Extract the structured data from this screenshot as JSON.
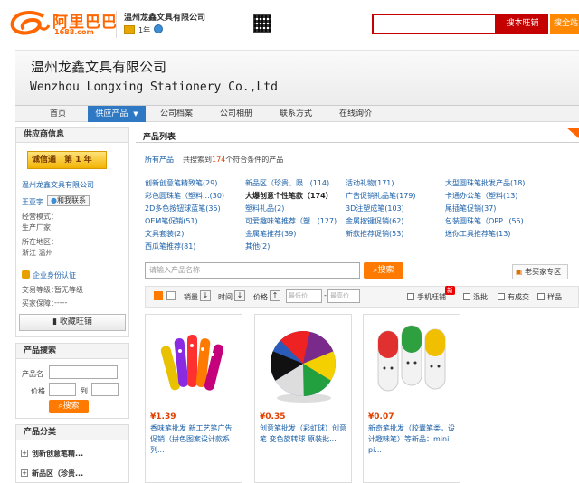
{
  "header": {
    "logo_cn": "阿里巴巴",
    "logo_url": "1688.com",
    "company_name": "温州龙鑫文具有限公司",
    "year_label": "1年",
    "search_placeholder": "",
    "search_shop_button": "搜本旺铺",
    "search_site_button": "搜全站"
  },
  "banner": {
    "title_cn": "温州龙鑫文具有限公司",
    "title_en": "Wenzhou Longxing Stationery Co.,Ltd"
  },
  "nav": {
    "items": [
      "首页",
      "供应产品",
      "公司档案",
      "公司相册",
      "联系方式",
      "在线询价"
    ],
    "active_index": 1
  },
  "supplier": {
    "heading": "供应商信息",
    "badge_text": "诚信通",
    "badge_year": "第 1 年",
    "company_link": "温州龙鑫文具有限公司",
    "contact_name": "王亚宇",
    "contact_button": "和我联系",
    "biz_model_label": "经营模式：",
    "biz_model_value": "生产厂家",
    "location_label": "所在地区：",
    "location_value": "浙江 温州",
    "verify_link": "企业身份认证",
    "trade_level_label": "交易等级：",
    "trade_level_value": "暂无等级",
    "buyer_eval_label": "买家保障：",
    "buyer_eval_value": "-----",
    "favorite_button": "收藏旺铺"
  },
  "product_search": {
    "heading": "产品搜索",
    "name_label": "产品名",
    "price_label": "价格",
    "price_to": "到",
    "button": "搜索"
  },
  "product_category": {
    "heading": "产品分类",
    "items": [
      "创新创意笔精...",
      "新品区（珍贵..."
    ]
  },
  "product_list": {
    "heading": "产品列表",
    "all_products_label": "所有产品",
    "count_prefix": "共搜索到",
    "count": "174",
    "count_suffix": "个符合条件的产品",
    "categories": [
      [
        "创新创意笔精致笔(29)",
        "新品区（珍贵、限...(114)",
        "活动礼物(171)",
        "大型圆珠笔批发产品(18)"
      ],
      [
        "彩色圆珠笔（塑料...(30)",
        "大爆创意个性笔款（174）",
        "广告促销礼品笔(179)",
        "卡通办公笔（塑料(13)"
      ],
      [
        "2D多色按钮球蓝笔(35)",
        "塑料礼品(2)",
        "3D注塑成笔(103)",
        "尾插笔促销(37)"
      ],
      [
        "OEM笔促销(51)",
        "可爱趣味笔推荐（塑...(127)",
        "金属按键促销(62)",
        "包装圆珠笔（OPP...(55)"
      ],
      [
        "文具套装(2)",
        "金属笔推荐(39)",
        "新款推荐促销(53)",
        "迷你工具推荐笔(13)"
      ],
      [
        "西瓜笔推荐(81)",
        "其他(2)",
        "",
        ""
      ]
    ],
    "search_placeholder": "请输入产品名称",
    "search_button": "搜索",
    "old_buyer_button": "老买家专区",
    "sort_labels": [
      "销量",
      "时间",
      "价格"
    ],
    "price_from_placeholder": "最低价",
    "price_to_placeholder": "最高价",
    "new_badge": "新",
    "filters": [
      "手机旺铺",
      "混批",
      "有成交",
      "样品"
    ]
  },
  "products": [
    {
      "price": "¥1.39",
      "title": "香味笔批发 新工艺笔广告促销（拼色图案设计款系列..."
    },
    {
      "price": "¥0.35",
      "title": "创意笔批发（彩虹球）创意笔 变色旋转球 原装批..."
    },
    {
      "price": "¥0.07",
      "title": "新奇笔批发（胶囊笔类，设计趣味笔）等新品：mini pi..."
    }
  ]
}
